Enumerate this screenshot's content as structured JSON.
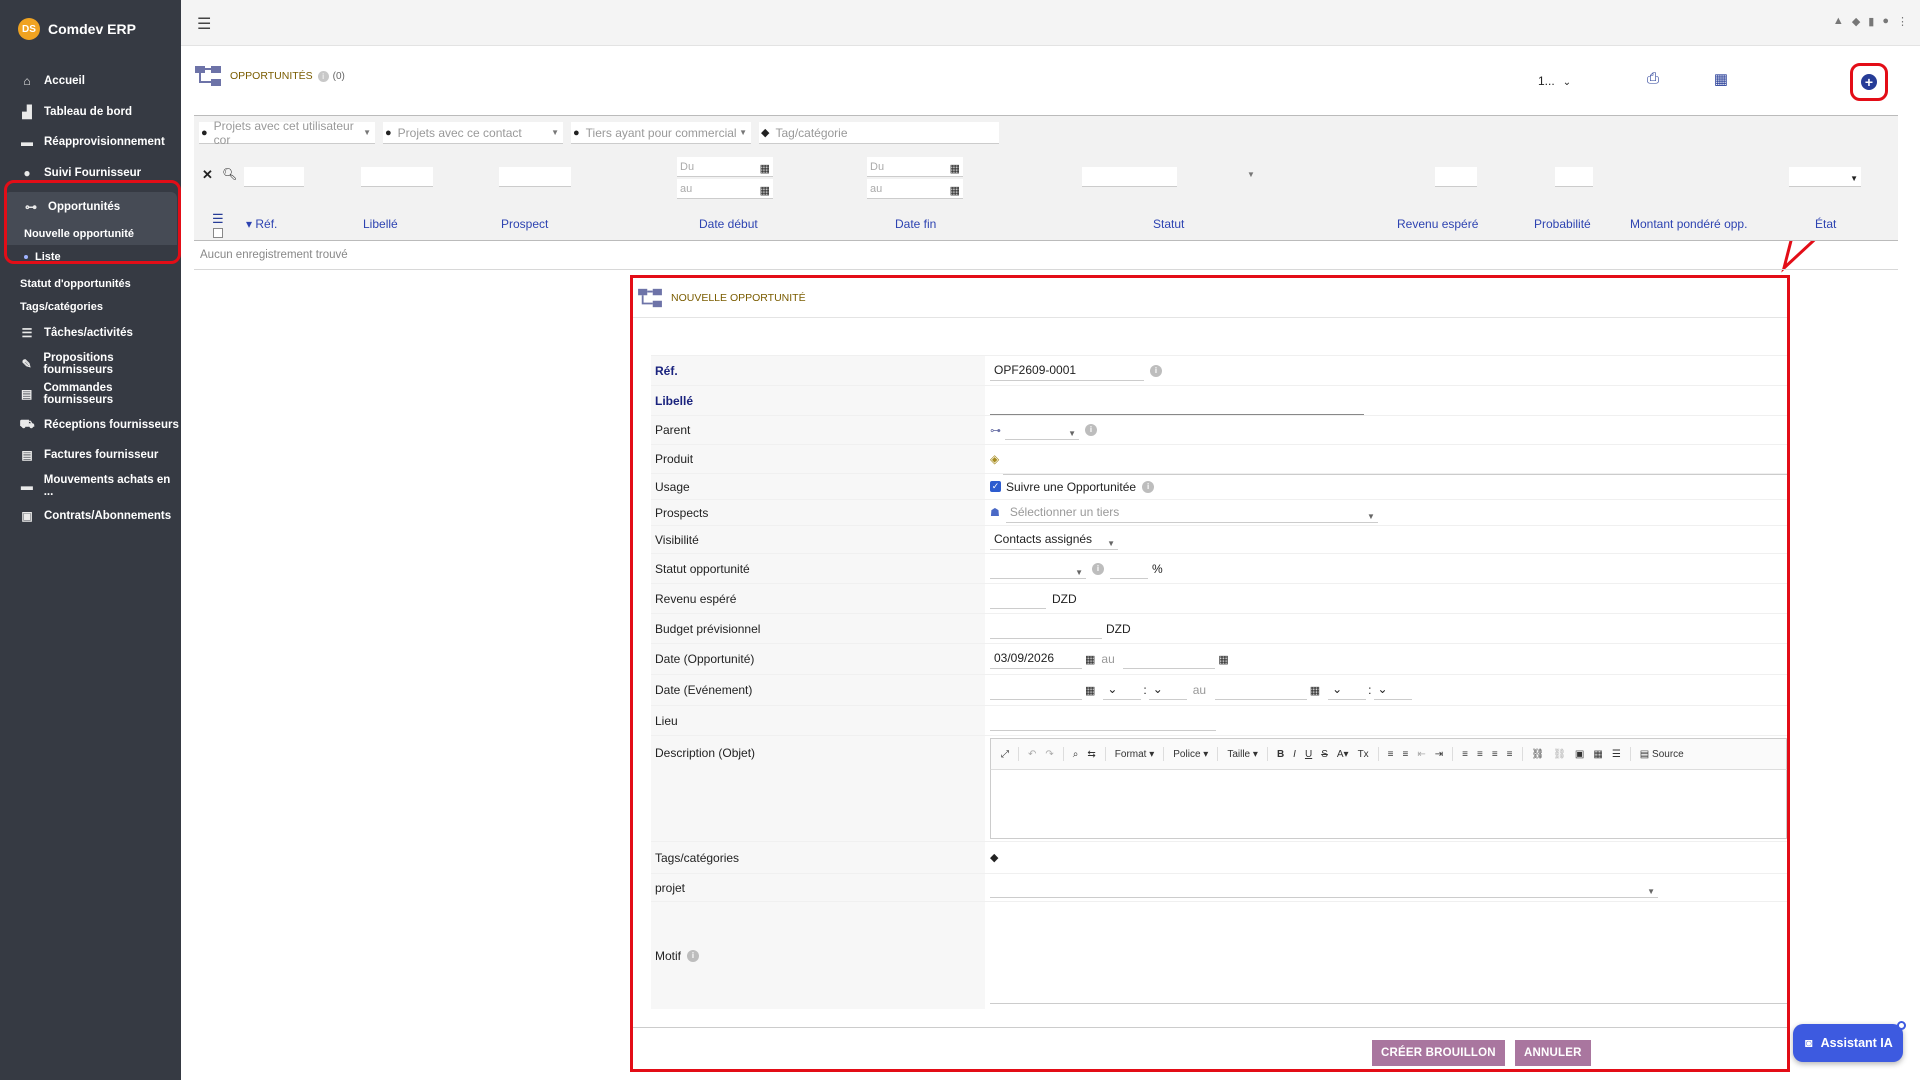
{
  "app": {
    "name": "Comdev ERP",
    "logo_text": "DS"
  },
  "sidebar": {
    "items": [
      {
        "label": "Accueil",
        "icon": "home-icon"
      },
      {
        "label": "Tableau de bord",
        "icon": "chart-icon"
      },
      {
        "label": "Réapprovisionnement",
        "icon": "truck-icon"
      },
      {
        "label": "Suivi Fournisseur",
        "icon": "users-icon"
      }
    ],
    "active_group": {
      "label": "Opportunités",
      "icon": "sitemap-icon",
      "sub": [
        {
          "label": "Nouvelle opportunité"
        },
        {
          "label": "Liste"
        }
      ]
    },
    "extra_sub": [
      {
        "label": "Statut d'opportunités"
      },
      {
        "label": "Tags/catégories"
      }
    ],
    "items2": [
      {
        "label": "Tâches/activités",
        "icon": "tasks-icon"
      },
      {
        "label": "Propositions fournisseurs",
        "icon": "file-sign-icon"
      },
      {
        "label": "Commandes fournisseurs",
        "icon": "file-icon"
      },
      {
        "label": "Réceptions fournisseurs",
        "icon": "dolly-icon"
      },
      {
        "label": "Factures fournisseur",
        "icon": "invoice-icon"
      },
      {
        "label": "Mouvements achats en ...",
        "icon": "truck-icon"
      },
      {
        "label": "Contrats/Abonnements",
        "icon": "suitcase-icon"
      }
    ]
  },
  "page": {
    "title": "OPPORTUNITÉS",
    "count": "(0)",
    "per_page": "1...",
    "no_records": "Aucun enregistrement trouvé"
  },
  "filters": {
    "user_projects_placeholder": "Projets avec cet utilisateur cor",
    "contact_projects_placeholder": "Projets avec ce contact",
    "thirdparty_placeholder": "Tiers ayant pour commercial",
    "tag_placeholder": "Tag/catégorie",
    "from": "Du",
    "to": "au"
  },
  "columns": [
    "Réf.",
    "Libellé",
    "Prospect",
    "Date début",
    "Date fin",
    "Statut",
    "Revenu espéré",
    "Probabilité",
    "Montant pondéré opp.",
    "État"
  ],
  "form": {
    "title": "NOUVELLE OPPORTUNITÉ",
    "ref_label": "Réf.",
    "ref_value": "OPF2609-0001",
    "libelle_label": "Libellé",
    "parent_label": "Parent",
    "produit_label": "Produit",
    "usage_label": "Usage",
    "usage_checkbox": "Suivre une Opportunitée",
    "prospects_label": "Prospects",
    "prospects_placeholder": "Sélectionner un tiers",
    "visibilite_label": "Visibilité",
    "visibilite_value": "Contacts assignés",
    "statut_label": "Statut opportunité",
    "percent": "%",
    "revenu_label": "Revenu espéré",
    "currency": "DZD",
    "budget_label": "Budget prévisionnel",
    "date_opp_label": "Date (Opportunité)",
    "date_opp_value": "03/09/2026",
    "au": "au",
    "date_evt_label": "Date (Evénement)",
    "lieu_label": "Lieu",
    "description_label": "Description (Objet)",
    "tags_label": "Tags/catégories",
    "projet_label": "projet",
    "motif_label": "Motif",
    "editor": {
      "format": "Format",
      "police": "Police",
      "taille": "Taille",
      "source": "Source"
    },
    "btn_create": "CRÉER BROUILLON",
    "btn_cancel": "ANNULER"
  },
  "assistant": {
    "label": "Assistant IA"
  },
  "colors": {
    "sidebar": "#363a43",
    "accent": "#263c97",
    "annotation": "#e30d17",
    "button": "#a9769f"
  }
}
